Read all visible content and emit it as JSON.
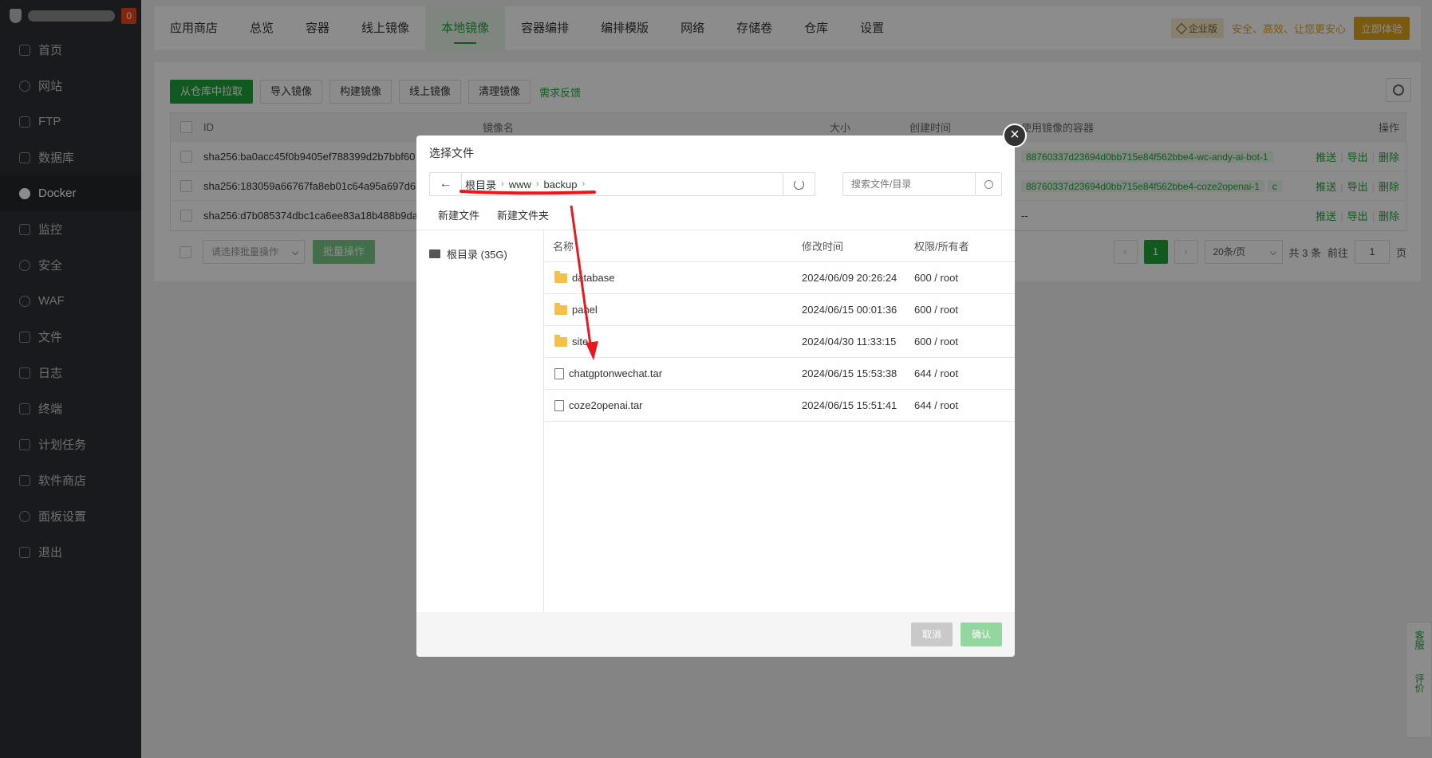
{
  "sidebar": {
    "badge": "0",
    "items": [
      {
        "label": "首页"
      },
      {
        "label": "网站"
      },
      {
        "label": "FTP"
      },
      {
        "label": "数据库"
      },
      {
        "label": "Docker"
      },
      {
        "label": "监控"
      },
      {
        "label": "安全"
      },
      {
        "label": "WAF"
      },
      {
        "label": "文件"
      },
      {
        "label": "日志"
      },
      {
        "label": "终端"
      },
      {
        "label": "计划任务"
      },
      {
        "label": "软件商店"
      },
      {
        "label": "面板设置"
      },
      {
        "label": "退出"
      }
    ]
  },
  "tabs": [
    "应用商店",
    "总览",
    "容器",
    "线上镜像",
    "本地镜像",
    "容器编排",
    "编排模版",
    "网络",
    "存储卷",
    "仓库",
    "设置"
  ],
  "promo": {
    "edition": "企业版",
    "slogan": "安全、高效、让您更安心",
    "try": "立即体验"
  },
  "toolbar": {
    "pull": "从仓库中拉取",
    "import": "导入镜像",
    "build": "构建镜像",
    "online": "线上镜像",
    "clean": "清理镜像",
    "feedback": "需求反馈"
  },
  "table": {
    "headers": {
      "id": "ID",
      "name": "镜像名",
      "size": "大小",
      "created": "创建时间",
      "containers": "使用镜像的容器",
      "ops": "操作"
    },
    "rows": [
      {
        "id": "sha256:ba0acc45f0b9405ef788399d2b7bbf60",
        "container": "88760337d23694d0bb715e84f562bbe4-wc-andy-ai-bot-1"
      },
      {
        "id": "sha256:183059a66767fa8eb01c64a95a697d67",
        "container": "88760337d23694d0bb715e84f562bbe4-coze2openai-1",
        "more": "c"
      },
      {
        "id": "sha256:d7b085374dbc1ca6ee83a18b488b9da0",
        "container": "--"
      }
    ],
    "ops": {
      "push": "推送",
      "export": "导出",
      "delete": "删除"
    }
  },
  "footer": {
    "batch_placeholder": "请选择批量操作",
    "batch_btn": "批量操作",
    "page": "1",
    "per_page": "20条/页",
    "total": "共 3 条",
    "goto": "前往",
    "goto_value": "1",
    "page_unit": "页"
  },
  "dialog": {
    "title": "选择文件",
    "back_icon": "←",
    "breadcrumb": [
      "根目录",
      "www",
      "backup"
    ],
    "search_placeholder": "搜索文件/目录",
    "new_file": "新建文件",
    "new_folder": "新建文件夹",
    "root": "根目录 (35G)",
    "columns": {
      "name": "名称",
      "time": "修改时间",
      "perm": "权限/所有者"
    },
    "files": [
      {
        "name": "database",
        "time": "2024/06/09 20:26:24",
        "perm": "600 / root",
        "type": "folder"
      },
      {
        "name": "panel",
        "time": "2024/06/15 00:01:36",
        "perm": "600 / root",
        "type": "folder"
      },
      {
        "name": "site",
        "time": "2024/04/30 11:33:15",
        "perm": "600 / root",
        "type": "folder"
      },
      {
        "name": "chatgptonwechat.tar",
        "time": "2024/06/15 15:53:38",
        "perm": "644 / root",
        "type": "file"
      },
      {
        "name": "coze2openai.tar",
        "time": "2024/06/15 15:51:41",
        "perm": "644 / root",
        "type": "file"
      }
    ],
    "cancel": "取消",
    "confirm": "确认",
    "close_icon": "×"
  },
  "float": {
    "service": "客服",
    "review": "评价"
  },
  "colors": {
    "accent": "#20a53a",
    "annotation": "#e8191e",
    "gold": "#e0a21b"
  }
}
